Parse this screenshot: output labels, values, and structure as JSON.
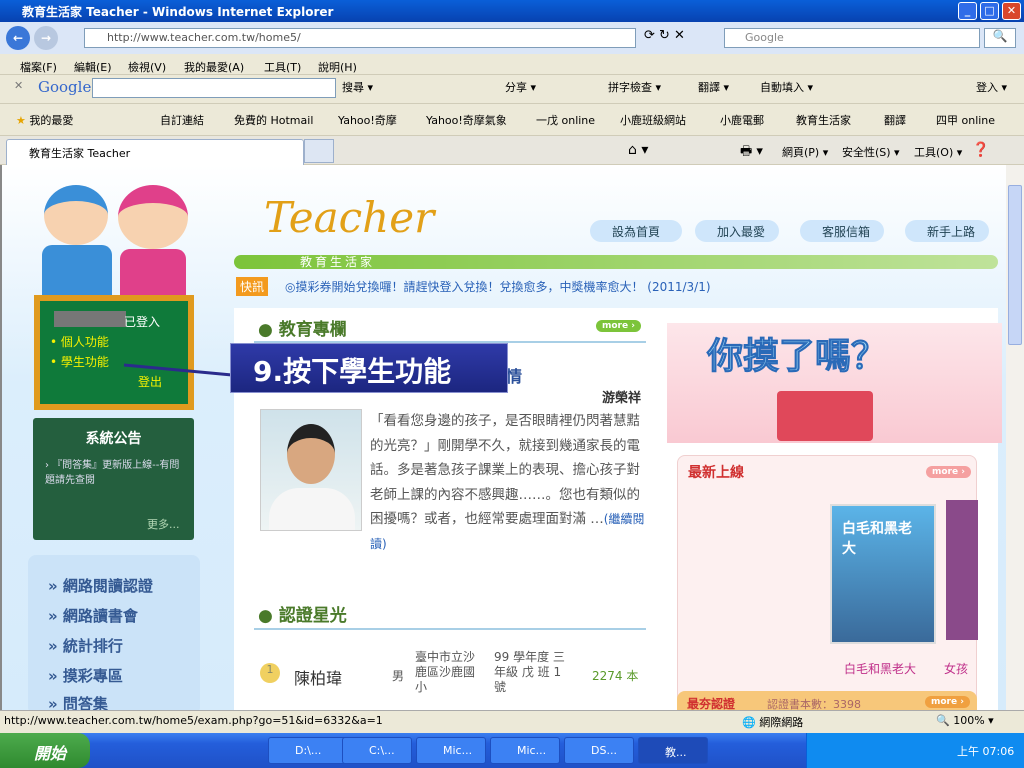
{
  "window": {
    "title": "教育生活家 Teacher - Windows Internet Explorer",
    "min": "_",
    "max": "□",
    "close": "✕"
  },
  "address": {
    "url": "http://www.teacher.com.tw/home5/",
    "search_placeholder": "Google"
  },
  "menu": [
    "檔案(F)",
    "編輯(E)",
    "檢視(V)",
    "我的最愛(A)",
    "工具(T)",
    "說明(H)"
  ],
  "google_bar": {
    "logo": "Google",
    "items": [
      "搜尋 ▾",
      "分享 ▾",
      "拼字檢查 ▾",
      "翻譯 ▾",
      "自動填入 ▾",
      "登入 ▾"
    ]
  },
  "favorites": {
    "label": "我的最愛",
    "items": [
      "自訂連結",
      "免費的 Hotmail",
      "Yahoo!奇摩",
      "Yahoo!奇摩氣象",
      "一戊 online",
      "小鹿班級網站",
      "小鹿電郵",
      "教育生活家",
      "翻譯",
      "四甲 online"
    ]
  },
  "tab": {
    "label": "教育生活家 Teacher"
  },
  "command_bar": [
    "網頁(P) ▾",
    "安全性(S) ▾",
    "工具(O) ▾"
  ],
  "site": {
    "logo": "Teacher",
    "logo_sub": "教育生活家",
    "header_buttons": [
      "設為首頁",
      "加入最愛",
      "客服信箱",
      "新手上路"
    ],
    "news_badge": "快訊",
    "news": "◎摸彩券開始兌換囉！請趕快登入兌換！兌換愈多，中獎機率愈大！ (2011/3/1)",
    "board": {
      "logged_in": "已登入",
      "links": [
        "個人功能",
        "學生功能"
      ],
      "logout": "登出"
    },
    "announce": {
      "title": "系統公告",
      "item": "『問答集』更新版上線--有問題請先查閱",
      "more": "更多..."
    },
    "nav": [
      "網路閱讀認證",
      "網路讀書會",
      "統計排行",
      "摸彩專區",
      "問答集"
    ],
    "column": {
      "title": "教育專欄",
      "more": "more ›",
      "headline_tail": "情",
      "author": "游榮祥",
      "body": "「看看您身邊的孩子，是否眼睛裡仍閃著慧黠的光亮？」剛開學不久，就接到幾通家長的電話。多是著急孩子課業上的表現、擔心孩子對老師上課的內容不感興趣……。您也有類似的困擾嗎？或者，也經常要處理面對滿 …",
      "read_more": "(繼續閱讀)"
    },
    "stars": {
      "title": "認證星光",
      "row": {
        "rank": "1",
        "name": "陳柏瑋",
        "gender": "男",
        "school": "臺中市立沙鹿區沙鹿國小",
        "class": "99 學年度 三年級 戊 班 1 號",
        "count": "2274 本"
      }
    },
    "banner": "你摸了嗎？",
    "new": {
      "title": "最新上線",
      "more": "more ›",
      "books": [
        "白毛和黑老大",
        "女孩"
      ],
      "cover_text": "白毛和黑老大"
    },
    "hot": {
      "title": "最夯認證",
      "count": "認證書本數：3398",
      "more": "more ›"
    }
  },
  "callout": "9.按下學生功能",
  "status": {
    "url": "http://www.teacher.com.tw/home5/exam.php?go=51&id=6332&a=1",
    "zone": "網際網路",
    "zoom": "100%"
  },
  "taskbar": {
    "start": "開始",
    "tasks": [
      "D:\\...",
      "C:\\...",
      "Mic...",
      "Mic...",
      "DS...",
      "教..."
    ],
    "clock": "上午 07:06"
  }
}
